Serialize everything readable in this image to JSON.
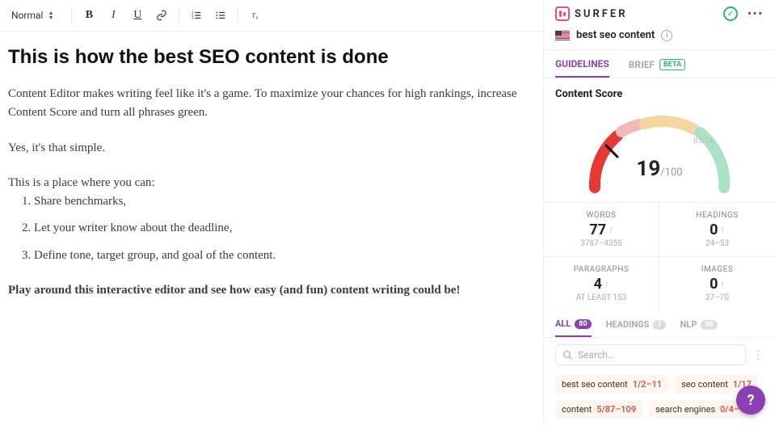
{
  "toolbar": {
    "style": "Normal"
  },
  "editor": {
    "title": "This is how the best SEO content is done",
    "p1": "Content Editor makes writing feel like it's a game. To maximize your chances for high rankings, increase Content Score and turn all phrases green.",
    "p2": "Yes, it's that simple.",
    "p3": "This is a place where you can:",
    "li1": "Share benchmarks,",
    "li2": "Let your writer know about the deadline,",
    "li3": "Define tone, target group, and goal of the content.",
    "p4": "Play around this interactive editor and see how easy (and fun) content writing could be!"
  },
  "side": {
    "brand": "SURFER",
    "keyword": "best seo content",
    "tabs": {
      "guidelines": "GUIDELINES",
      "brief": "BRIEF",
      "beta": "BETA"
    },
    "score_title": "Content Score",
    "gauge": {
      "beta": "BETA",
      "value": "19",
      "max": "/100"
    },
    "stats": {
      "words_label": "WORDS",
      "words_val": "77",
      "words_range": "3787–4355",
      "headings_label": "HEADINGS",
      "headings_val": "0",
      "headings_range": "24–53",
      "paragraphs_label": "PARAGRAPHS",
      "paragraphs_val": "4",
      "paragraphs_range": "AT LEAST 153",
      "images_label": "IMAGES",
      "images_val": "0",
      "images_range": "27–70"
    },
    "term_tabs": {
      "all": "ALL",
      "all_count": "80",
      "headings": "HEADINGS",
      "headings_count": "7",
      "nlp": "NLP",
      "nlp_count": "38"
    },
    "search_placeholder": "Search...",
    "terms": [
      {
        "name": "best seo content",
        "count": "1/2–11"
      },
      {
        "name": "seo content",
        "count": "1/17"
      },
      {
        "name": "content",
        "count": "5/87–109"
      },
      {
        "name": "search engines",
        "count": "0/4–11"
      }
    ]
  }
}
